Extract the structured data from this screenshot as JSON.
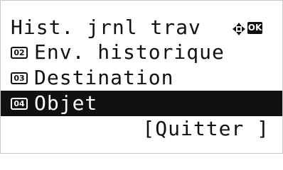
{
  "screen": {
    "title": "Hist. jrnl trav",
    "ok_label": "OK",
    "nav_icon": "four-way-arrow-icon"
  },
  "menu": {
    "items": [
      {
        "number": "02",
        "label": "Env. historique",
        "selected": false
      },
      {
        "number": "03",
        "label": "Destination",
        "selected": false
      },
      {
        "number": "04",
        "label": "Objet",
        "selected": true
      }
    ]
  },
  "softkey": {
    "label": "[Quitter ]"
  }
}
